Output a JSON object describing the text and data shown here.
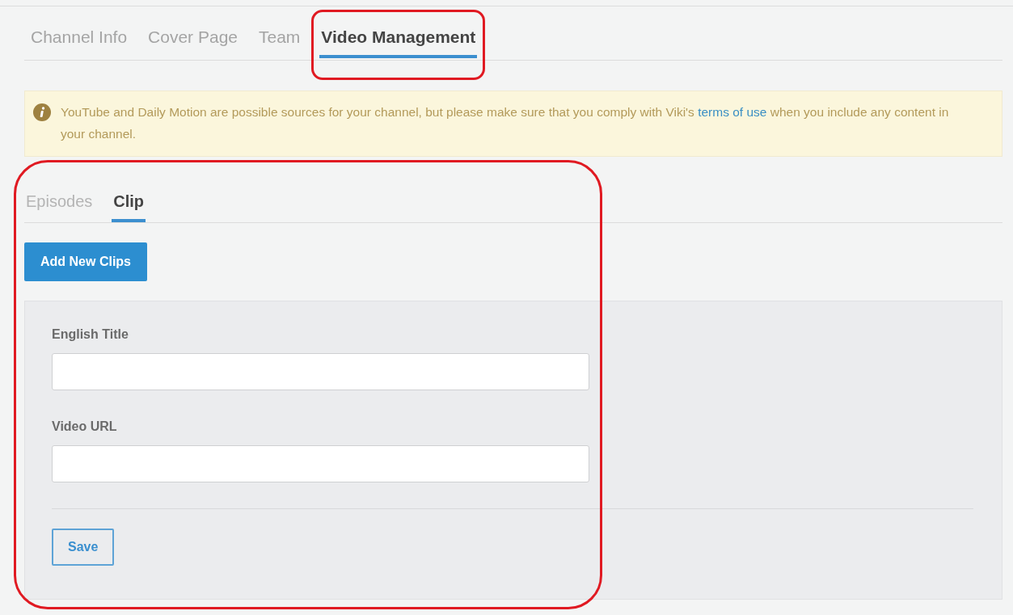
{
  "tabs": [
    {
      "label": "Channel Info",
      "selected": false,
      "highlighted": false
    },
    {
      "label": "Cover Page",
      "selected": false,
      "highlighted": false
    },
    {
      "label": "Team",
      "selected": false,
      "highlighted": false
    },
    {
      "label": "Video Management",
      "selected": true,
      "highlighted": true
    }
  ],
  "notice": {
    "text": "YouTube and Daily Motion are possible sources for your channel, but please make sure that you comply with Viki's",
    "link": "terms of use",
    "text_after": "when you include any content in your channel."
  },
  "video_section": {
    "highlighted": true,
    "subtabs": [
      {
        "label": "Episodes",
        "selected": false
      },
      {
        "label": "Clip",
        "selected": true
      }
    ],
    "add_button": "Add New Clips",
    "form": {
      "fields": [
        {
          "label": "English Title"
        },
        {
          "label": "Video URL"
        }
      ],
      "save_button": "Save"
    }
  }
}
